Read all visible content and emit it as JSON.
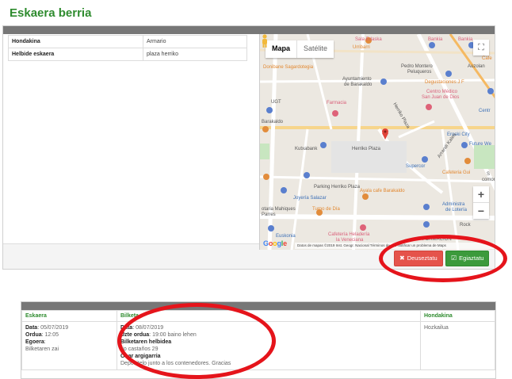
{
  "page": {
    "title": "Eskaera berria"
  },
  "details": {
    "rows": [
      {
        "label": "Hondakina",
        "value": "Armario"
      },
      {
        "label": "Helbide eskaera",
        "value": "plaza herriko"
      }
    ]
  },
  "map": {
    "type_map": "Mapa",
    "type_satellite": "Satélite",
    "fullscreen_icon": "⛶",
    "zoom_in": "+",
    "zoom_out": "−",
    "google": "Google",
    "attribution": "Datos de mapas ©2019 Inst. Geogr. Nacional   Términos de uso   Notificar un problema de Maps",
    "labels": {
      "sala_edaska": "Sala Edaska",
      "bankia1": "Bankia",
      "bankia2": "Bankia",
      "cafe": "Cafe",
      "urribarri": "Urribarri",
      "pedro": "Pedro Montero",
      "peluqueros": "Peluqueros",
      "auzolan": "Auzolan",
      "donibane": "Donibane Sagardotegia",
      "ayuntamiento": "Ayuntamiento",
      "de_barakaldo": "de Barakaldo",
      "degustaciones": "Degustaciones J F",
      "centro": "Centro Médico",
      "san_juan": "San Juan de Dios",
      "cent": "Centr",
      "ugt": "UGT",
      "farmacia": "Farmacia",
      "barakaldo": "Barakaldo",
      "herriko_plaza_st": "Herriko Plaza",
      "kutxabank": "Kutxabank",
      "herriko_plaza": "Herriko Plaza",
      "eroski": "Eroski City",
      "future": "Future We",
      "supercor": "Supercor",
      "cafeteria_gui": "Cafeteria Gui",
      "arrandi": "Arrandi Kalea",
      "parking": "Parking Herriko Plaza",
      "ayala": "Ayala cafe Barakaldo",
      "joyeria": "Joyería Salazar",
      "loteria": "Administra",
      "de_loteria": "de Lotería",
      "otaria": "otaria Mahiques",
      "parres": "Parres",
      "turno": "Turno de Día",
      "heladeria": "Cafetería Heladería",
      "venecianа": "la Veneciana",
      "rocky": "Rock",
      "formacion": "FORMACIÓN",
      "euskonia": "Euskonia",
      "sbar": "S",
      "comor": "comor"
    }
  },
  "actions": {
    "cancel_icon": "✖",
    "cancel_label": "Deuseztatu",
    "confirm_icon": "☑",
    "confirm_label": "Egiaztatu"
  },
  "order": {
    "headers": {
      "eskaera": "Eskaera",
      "bilketa": "Bilketa",
      "hondakina": "Hondakina"
    },
    "eskaera": {
      "data_label": "Data",
      "data_value": "05/07/2019",
      "ordua_label": "Ordua",
      "ordua_value": "12:05",
      "egoera_label": "Egoera",
      "egoera_value": "Bilketaren zai"
    },
    "bilketa": {
      "data_label": "Data",
      "data_value": "08/07/2019",
      "uzte_label": "Uzte ordua",
      "uzte_value": "19:00 baino lehen",
      "helbidea_label": "Bilketaren helbidea",
      "helbidea_value": "rio castaños 29",
      "ohar_label": "Ohar argigarria",
      "ohar_value": "Depositelo junto a los contenedores. Gracias"
    },
    "hondakina": {
      "value": "Hozkailua"
    }
  },
  "colors": {
    "accent_green": "#2e8b2e",
    "cancel_red": "#e5534b",
    "annotation_red": "#e5141b"
  }
}
